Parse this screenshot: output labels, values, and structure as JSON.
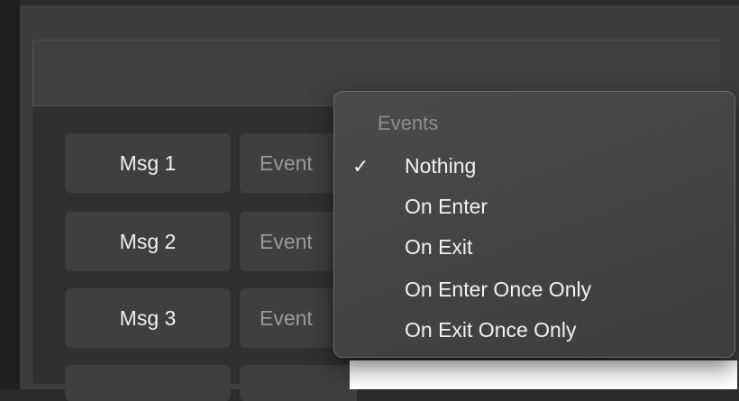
{
  "rows": [
    {
      "msg_label": "Msg 1",
      "event_label": "Event"
    },
    {
      "msg_label": "Msg 2",
      "event_label": "Event"
    },
    {
      "msg_label": "Msg 3",
      "event_label": "Event"
    }
  ],
  "dropdown": {
    "header": "Events",
    "checkmark": "✓",
    "selected": "Nothing",
    "items": [
      "Nothing",
      "On Enter",
      "On Exit",
      "On Enter Once Only",
      "On Exit Once Only"
    ]
  }
}
